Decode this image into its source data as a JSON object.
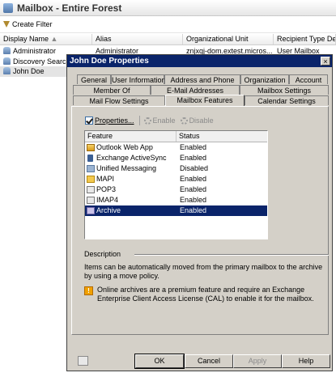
{
  "console": {
    "title": "Mailbox - Entire Forest",
    "toolbar": {
      "create_filter": "Create Filter"
    },
    "columns": [
      "Display Name",
      "Alias",
      "Organizational Unit",
      "Recipient Type Deta"
    ],
    "rows": [
      {
        "name": "Administrator",
        "alias": "Administrator",
        "ou": "znjxqj-dom.extest.micros...",
        "type": "User Mailbox"
      },
      {
        "name": "Discovery Search",
        "alias": "",
        "ou": "",
        "type": ""
      },
      {
        "name": "John Doe",
        "alias": "",
        "ou": "",
        "type": ""
      }
    ]
  },
  "dialog": {
    "title": "John Doe Properties",
    "close": "×",
    "tabs_row1": [
      "General",
      "User Information",
      "Address and Phone",
      "Organization",
      "Account"
    ],
    "tabs_row2": [
      "Member Of",
      "E-Mail Addresses",
      "Mailbox Settings"
    ],
    "tabs_row3": [
      "Mail Flow Settings",
      "Mailbox Features",
      "Calendar Settings"
    ],
    "active_tab": "Mailbox Features",
    "feature_toolbar": {
      "properties": "Properties...",
      "enable": "Enable",
      "disable": "Disable"
    },
    "list_headers": {
      "feature": "Feature",
      "status": "Status"
    },
    "features": [
      {
        "name": "Outlook Web App",
        "status": "Enabled",
        "icon": "outlook-web-app-icon"
      },
      {
        "name": "Exchange ActiveSync",
        "status": "Enabled",
        "icon": "activesync-icon"
      },
      {
        "name": "Unified Messaging",
        "status": "Disabled",
        "icon": "unified-messaging-icon"
      },
      {
        "name": "MAPI",
        "status": "Enabled",
        "icon": "mapi-icon"
      },
      {
        "name": "POP3",
        "status": "Enabled",
        "icon": "pop3-icon"
      },
      {
        "name": "IMAP4",
        "status": "Enabled",
        "icon": "imap4-icon"
      },
      {
        "name": "Archive",
        "status": "Enabled",
        "icon": "archive-icon",
        "selected": true
      }
    ],
    "description_label": "Description",
    "description_text": "Items can be automatically moved from the primary mailbox to the archive by using a move policy.",
    "warning_text": "Online archives are a premium feature and require an Exchange Enterprise Client Access License (CAL) to enable it for the mailbox.",
    "buttons": {
      "ok": "OK",
      "cancel": "Cancel",
      "apply": "Apply",
      "help": "Help"
    }
  },
  "colors": {
    "title_bar": "#0a246a",
    "selection": "#0a246a",
    "dialog_face": "#d4d0c8"
  }
}
